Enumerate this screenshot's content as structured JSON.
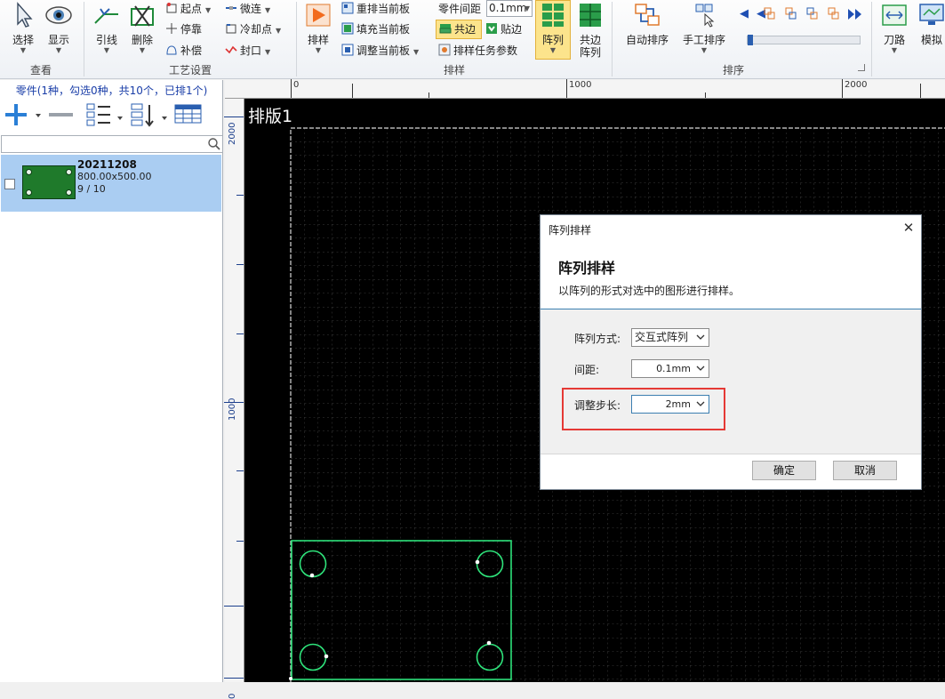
{
  "ribbon": {
    "view_group": {
      "label": "查看",
      "select": "选择",
      "display": "显示"
    },
    "process_group": {
      "label": "工艺设置",
      "lead": "引线",
      "delete": "删除",
      "start_point": "起点",
      "stop": "停靠",
      "compensate": "补偿",
      "micro_joint": "微连",
      "cooling_point": "冷却点",
      "seal": "封口"
    },
    "nesting_group": {
      "label": "排样",
      "nest": "排样",
      "renest_current": "重排当前板",
      "fill_current": "填充当前板",
      "adjust_current": "调整当前板",
      "part_spacing_label": "零件间距",
      "part_spacing_value": "0.1mm",
      "common_edge": "共边",
      "stick_edge": "贴边",
      "task_params": "排样任务参数",
      "array": "阵列",
      "common_edge_array_1": "共边",
      "common_edge_array_2": "阵列"
    },
    "sort_group": {
      "label": "排序",
      "auto_sort": "自动排序",
      "manual_sort": "手工排序"
    },
    "path_group": {
      "tool_path": "刀路",
      "simulate": "模拟"
    }
  },
  "parts_panel": {
    "summary": "零件(1种，勾选0种，共10个，已排1个)",
    "search_placeholder": "",
    "items": [
      {
        "name": "20211208",
        "size": "800.00x500.00",
        "count": "9 / 10"
      }
    ]
  },
  "canvas": {
    "sheet_label": "排版1",
    "ruler_top_labels": [
      "0",
      "1000",
      "2000"
    ],
    "ruler_left_labels": [
      "2000",
      "1000",
      "0"
    ]
  },
  "dialog": {
    "title": "阵列排样",
    "heading": "阵列排样",
    "description": "以阵列的形式对选中的图形进行排样。",
    "fields": {
      "array_mode_label": "阵列方式:",
      "array_mode_value": "交互式阵列",
      "spacing_label": "间距:",
      "spacing_value": "0.1mm",
      "step_label": "调整步长:",
      "step_value": "2mm"
    },
    "ok": "确定",
    "cancel": "取消"
  },
  "colors": {
    "accent": "#3c7fb1",
    "highlight": "#e53935",
    "part_outline": "#2ee27a",
    "selection": "#aacdf2"
  }
}
